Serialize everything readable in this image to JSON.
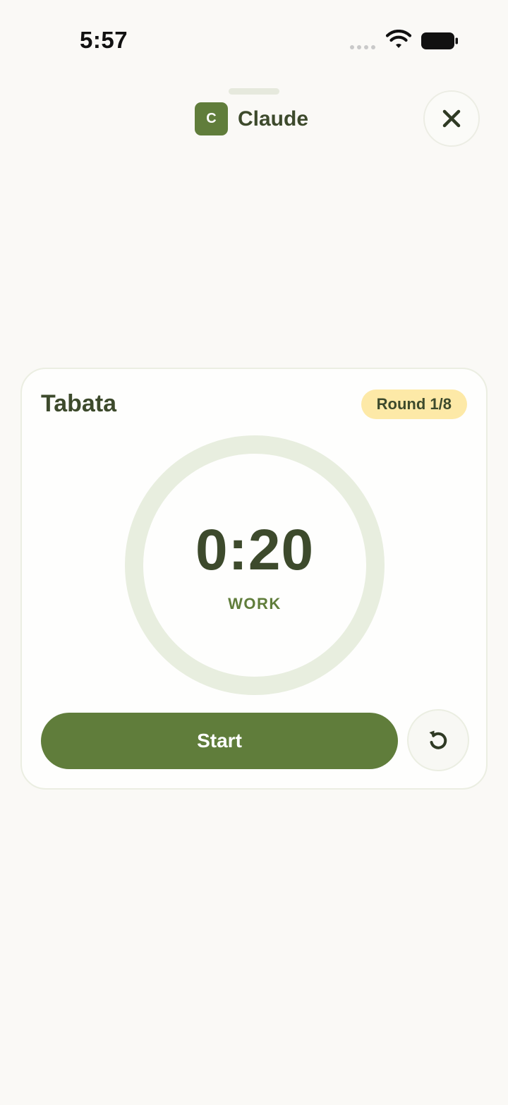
{
  "status_bar": {
    "time": "5:57"
  },
  "header": {
    "logo_letter": "C",
    "app_name": "Claude",
    "icons": {
      "close": "close-icon"
    }
  },
  "timer_card": {
    "title": "Tabata",
    "round_badge": "Round 1/8",
    "time_remaining": "0:20",
    "phase": "WORK",
    "progress": 0,
    "start_label": "Start",
    "icons": {
      "reset": "reset-icon"
    }
  },
  "colors": {
    "accent": "#607d3b",
    "text_dark": "#3d4a2c",
    "badge_bg": "#fde9a7",
    "ring_track": "#e8eedf",
    "background": "#faf9f6"
  }
}
